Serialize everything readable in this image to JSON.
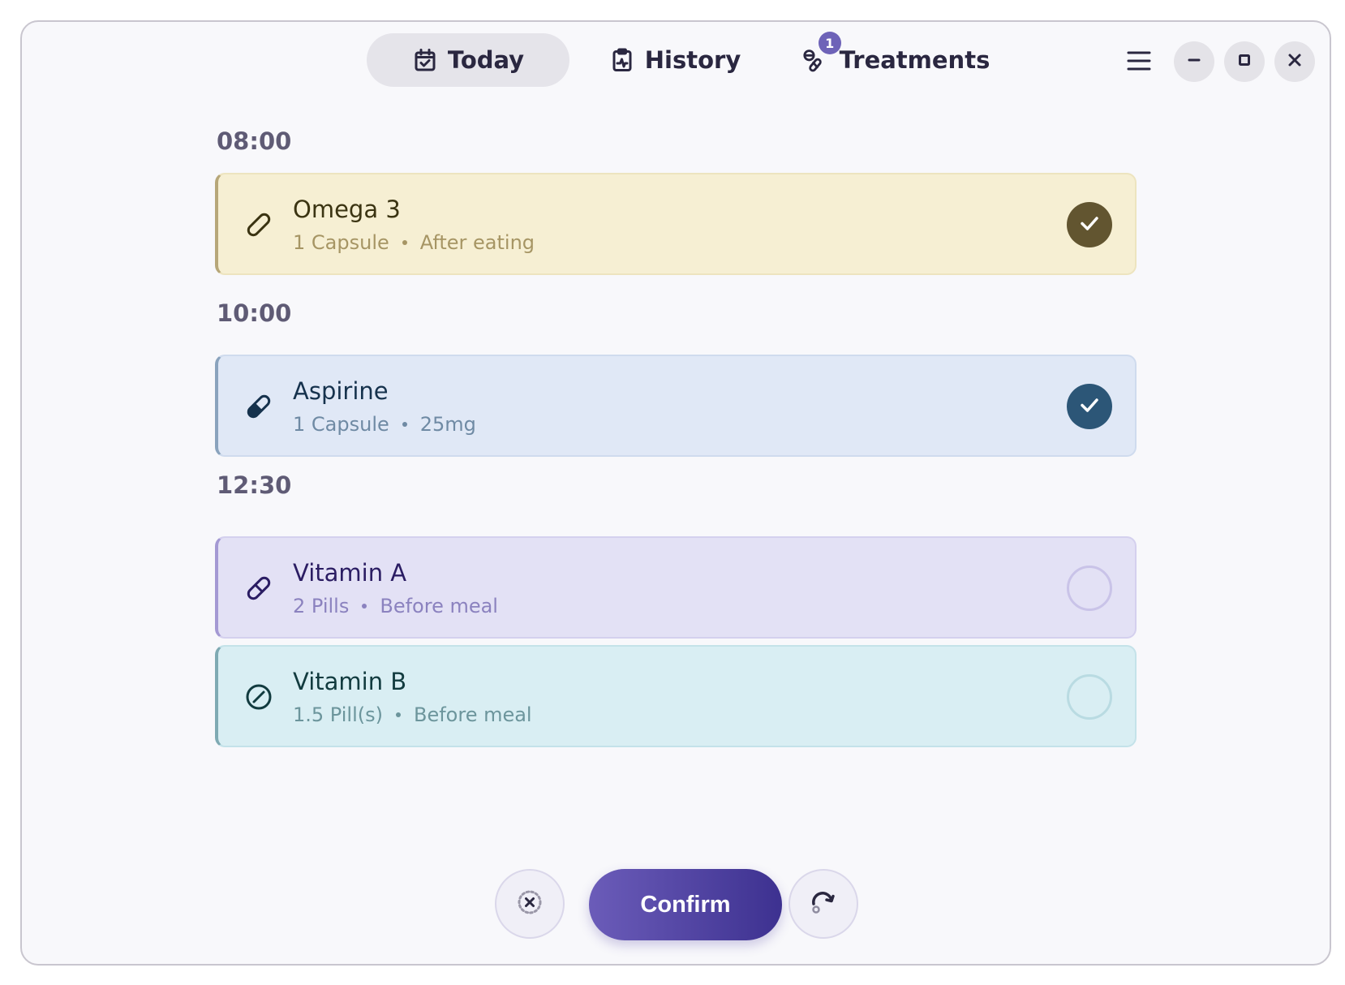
{
  "header": {
    "tabs": [
      {
        "label": "Today",
        "icon": "calendar-check-icon",
        "active": true
      },
      {
        "label": "History",
        "icon": "clipboard-chart-icon",
        "active": false
      },
      {
        "label": "Treatments",
        "icon": "pills-icon",
        "active": false,
        "badge": "1"
      }
    ],
    "menu_icon": "hamburger-menu-icon",
    "window_controls": [
      "minimize",
      "maximize",
      "close"
    ]
  },
  "schedule": [
    {
      "time": "08:00",
      "items": [
        {
          "name": "Omega 3",
          "dose": "1 Capsule",
          "note": "After eating",
          "taken": true,
          "icon": "capsule-icon",
          "color": "#f6efd3",
          "accent": "#625530"
        }
      ]
    },
    {
      "time": "10:00",
      "items": [
        {
          "name": "Aspirine",
          "dose": "1 Capsule",
          "note": "25mg",
          "taken": true,
          "icon": "capsule-half-filled-icon",
          "color": "#e0e8f6",
          "accent": "#2c5677"
        }
      ]
    },
    {
      "time": "12:30",
      "items": [
        {
          "name": "Vitamin A",
          "dose": "2 Pills",
          "note": "Before meal",
          "taken": false,
          "icon": "pill-icon",
          "color": "#e3e1f5",
          "accent": "#c9c3e8"
        },
        {
          "name": "Vitamin B",
          "dose": "1.5 Pill(s)",
          "note": "Before meal",
          "taken": false,
          "icon": "round-tablet-icon",
          "color": "#d9eef3",
          "accent": "#b9dbe2"
        }
      ]
    }
  ],
  "actions": {
    "skip_icon": "skip-dose-icon",
    "confirm_label": "Confirm",
    "snooze_icon": "reschedule-icon"
  }
}
